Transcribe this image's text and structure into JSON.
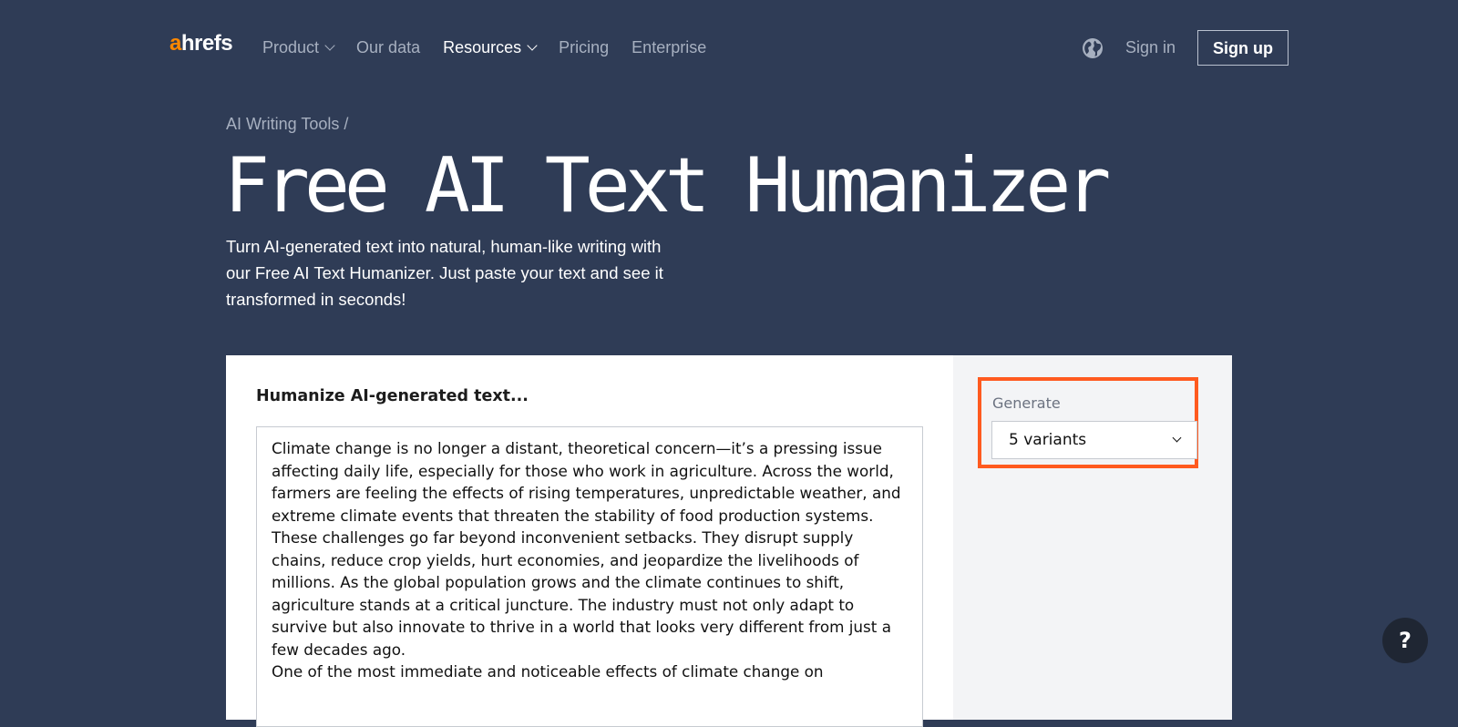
{
  "header": {
    "logo_accent": "a",
    "logo_rest": "hrefs",
    "nav": [
      {
        "label": "Product",
        "has_dropdown": true
      },
      {
        "label": "Our data",
        "has_dropdown": false
      },
      {
        "label": "Resources",
        "has_dropdown": true
      },
      {
        "label": "Pricing",
        "has_dropdown": false
      },
      {
        "label": "Enterprise",
        "has_dropdown": false
      }
    ],
    "language_icon": "globe-icon",
    "signin_label": "Sign in",
    "signup_label": "Sign up"
  },
  "hero": {
    "breadcrumb": "AI Writing Tools /",
    "title": "Free AI Text Humanizer",
    "subtitle": "Turn AI-generated text into natural, human-like writing with our Free AI Text Humanizer. Just paste your text and see it transformed in seconds!"
  },
  "tool": {
    "input_label": "Humanize AI-generated text...",
    "input_paragraphs": [
      "Climate change is no longer a distant, theoretical concern—it’s a pressing issue affecting daily life, especially for those who work in agriculture. Across the world, farmers are feeling the effects of rising temperatures, unpredictable weather, and extreme climate events that threaten the stability of food production systems. These challenges go far beyond inconvenient setbacks. They disrupt supply chains, reduce crop yields, hurt economies, and jeopardize the livelihoods of millions. As the global population grows and the climate continues to shift, agriculture stands at a critical juncture. The industry must not only adapt to survive but also innovate to thrive in a world that looks very different from just a few decades ago.",
      "One of the most immediate and noticeable effects of climate change on"
    ],
    "generate_label": "Generate",
    "generate_value": "5 variants"
  },
  "colors": {
    "background": "#2f3c56",
    "logo_accent": "#ff8800",
    "highlight": "#ff5a1f",
    "side_panel": "#f3f4f6"
  },
  "help_label": "?"
}
